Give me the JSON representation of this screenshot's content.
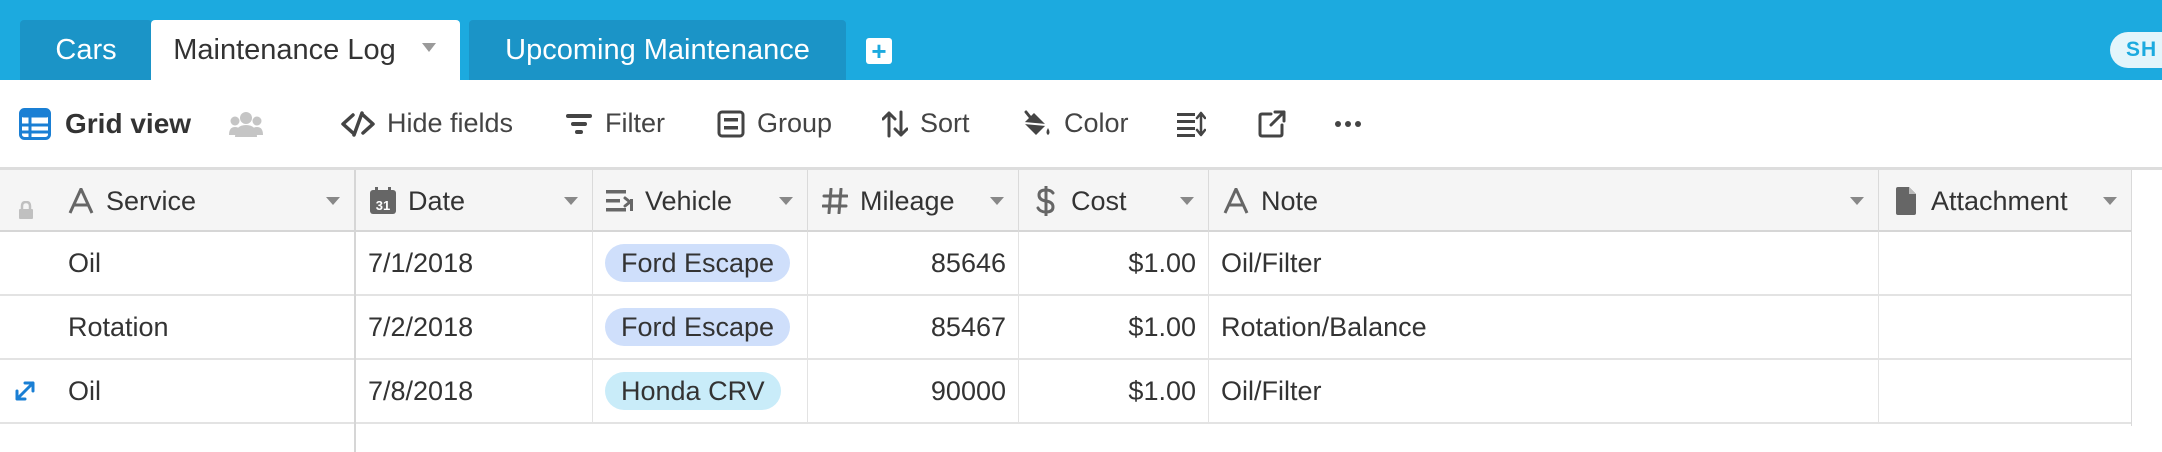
{
  "tabs": [
    {
      "label": "Cars",
      "active": false
    },
    {
      "label": "Maintenance Log",
      "active": true
    },
    {
      "label": "Upcoming Maintenance",
      "active": false
    }
  ],
  "user_initials": "SH",
  "toolbar": {
    "view_name": "Grid view",
    "hide_fields": "Hide fields",
    "filter": "Filter",
    "group": "Group",
    "sort": "Sort",
    "color": "Color"
  },
  "columns": [
    {
      "label": "Service",
      "icon": "text-icon"
    },
    {
      "label": "Date",
      "icon": "calendar-icon"
    },
    {
      "label": "Vehicle",
      "icon": "link-record-icon"
    },
    {
      "label": "Mileage",
      "icon": "number-icon"
    },
    {
      "label": "Cost",
      "icon": "currency-icon"
    },
    {
      "label": "Note",
      "icon": "text-icon"
    },
    {
      "label": "Attachment",
      "icon": "file-icon"
    }
  ],
  "rows": [
    {
      "service": "Oil",
      "date": "7/1/2018",
      "vehicle": "Ford Escape",
      "mileage": "85646",
      "cost": "$1.00",
      "note": "Oil/Filter",
      "attachment": "",
      "expand_visible": false
    },
    {
      "service": "Rotation",
      "date": "7/2/2018",
      "vehicle": "Ford Escape",
      "mileage": "85467",
      "cost": "$1.00",
      "note": "Rotation/Balance",
      "attachment": "",
      "expand_visible": false
    },
    {
      "service": "Oil",
      "date": "7/8/2018",
      "vehicle": "Honda CRV",
      "mileage": "90000",
      "cost": "$1.00",
      "note": "Oil/Filter",
      "attachment": "",
      "expand_visible": true
    }
  ],
  "colors": {
    "header_bg": "#1caadf",
    "ford_escape_pill": "#cfdffb",
    "honda_crv_pill": "#c9ecf9",
    "accent_blue": "#1a7fd4"
  }
}
